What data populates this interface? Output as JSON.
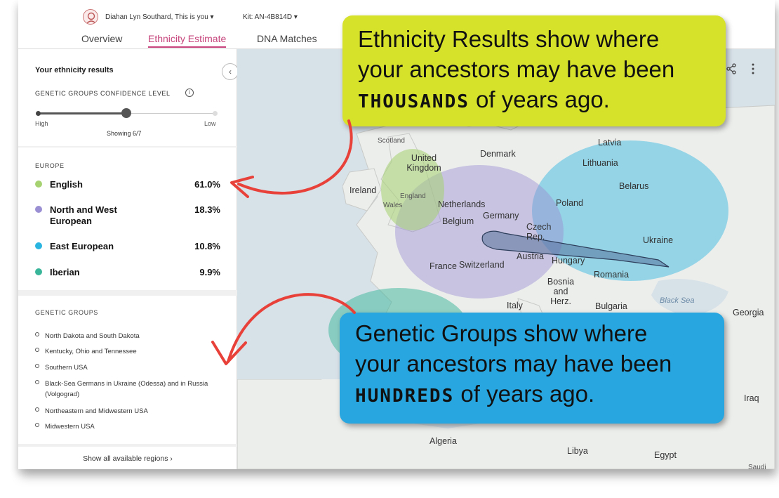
{
  "header": {
    "user_name": "Diahan Lyn Southard, This is you ▾",
    "kit_id": "Kit: AN-4B814D ▾",
    "tabs": [
      "Overview",
      "Ethnicity Estimate",
      "DNA Matches"
    ]
  },
  "sidebar": {
    "title": "Your ethnicity results",
    "collapse": "‹",
    "confidence_label": "GENETIC GROUPS CONFIDENCE LEVEL",
    "info_icon": "i",
    "slider": {
      "level": 0.5,
      "high": "High",
      "low": "Low",
      "showing": "Showing 6/7"
    },
    "region_label": "EUROPE",
    "ethnicities": [
      {
        "name": "English",
        "pct": "61.0%",
        "color": "#a6d271"
      },
      {
        "name": "North and West European",
        "pct": "18.3%",
        "color": "#9b8fd3"
      },
      {
        "name": "East European",
        "pct": "10.8%",
        "color": "#2ab4e0"
      },
      {
        "name": "Iberian",
        "pct": "9.9%",
        "color": "#39b59a"
      }
    ],
    "genetic_groups_label": "GENETIC GROUPS",
    "genetic_groups": [
      "North Dakota and South Dakota",
      "Kentucky, Ohio and Tennessee",
      "Southern USA",
      "Black-Sea Germans in Ukraine (Odessa) and in Russia (Volgograd)",
      "Northeastern and Midwestern USA",
      "Midwestern USA"
    ],
    "show_all": "Show all available regions ›"
  },
  "map": {
    "share_icon": "share-icon",
    "more_icon": "more-vertical-icon",
    "labels": {
      "scotland": "Scotland",
      "uk": "United Kingdom",
      "england": "England",
      "wales": "Wales",
      "ireland": "Ireland",
      "denmark": "Denmark",
      "latvia": "Latvia",
      "lithuania": "Lithuania",
      "belarus": "Belarus",
      "netherlands": "Netherlands",
      "germany": "Germany",
      "belgium": "Belgium",
      "poland": "Poland",
      "czech": "Czech Rep.",
      "ukraine": "Ukraine",
      "france": "France",
      "switzerland": "Switzerland",
      "austria": "Austria",
      "hungary": "Hungary",
      "romania": "Romania",
      "bosnia": "Bosnia and Herz.",
      "italy": "Italy",
      "bulgaria": "Bulgaria",
      "black_sea": "Black Sea",
      "georgia": "Georgia",
      "iraq": "Iraq",
      "algeria": "Algeria",
      "libya": "Libya",
      "egypt": "Egypt",
      "saudi": "Saudi"
    }
  },
  "callouts": {
    "yellow": {
      "line1": "Ethnicity Results show where",
      "line2": "your ancestors may have been",
      "emphasis": "THOUSANDS",
      "line3_rest": " of years ago."
    },
    "blue": {
      "line1": "Genetic Groups show where",
      "line2": "your ancestors may have been",
      "emphasis": "HUNDREDS",
      "line3_rest": " of years ago."
    }
  }
}
